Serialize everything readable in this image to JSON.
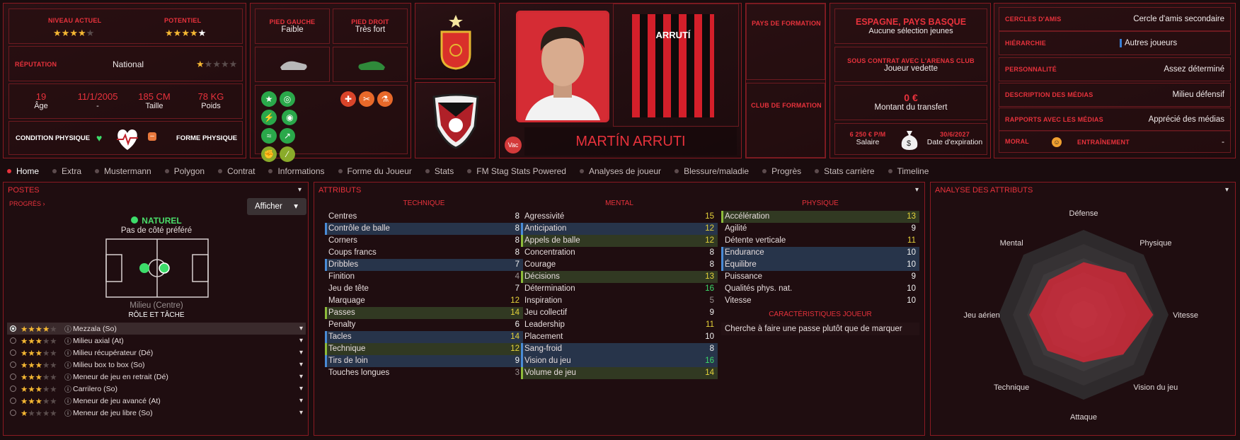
{
  "profile": {
    "current_level_label": "NIVEAU ACTUEL",
    "current_level_stars": 3.5,
    "potential_label": "POTENTIEL",
    "potential_stars": 4,
    "reputation_label": "RÉPUTATION",
    "reputation_value": "National",
    "reputation_stars": 0.5,
    "age": "19",
    "age_label": "Âge",
    "dob": "11/1/2005",
    "dob_label": "-",
    "height": "185 CM",
    "height_label": "Taille",
    "weight": "78 KG",
    "weight_label": "Poids",
    "condition_label": "CONDITION PHYSIQUE",
    "form_label": "FORME PHYSIQUE",
    "left_foot_label": "PIED GAUCHE",
    "left_foot_value": "Faible",
    "right_foot_label": "PIED DROIT",
    "right_foot_value": "Très fort",
    "name": "MARTÍN ARRUTI",
    "vac_badge": "Vac",
    "shirt_name": "ARRUTÍ",
    "training_nation_label": "PAYS DE FORMATION",
    "training_club_label": "CLUB DE FORMATION",
    "nationality": "ESPAGNE, PAYS BASQUE",
    "national_caps": "Aucune sélection jeunes",
    "contract_label": "SOUS CONTRAT AVEC L'ARENAS CLUB",
    "contract_status": "Joueur vedette",
    "transfer_value": "0 €",
    "transfer_label": "Montant du transfert",
    "salary": "6 250 € P/M",
    "salary_label": "Salaire",
    "expiry": "30/6/2027",
    "expiry_label": "Date d'expiration"
  },
  "right_info": [
    {
      "label": "CERCLES D'AMIS",
      "value": "Cercle d'amis secondaire"
    },
    {
      "label": "HIÉRARCHIE",
      "value": "Autres joueurs"
    },
    {
      "label": "PERSONNALITÉ",
      "value": "Assez déterminé"
    },
    {
      "label": "DESCRIPTION DES MÉDIAS",
      "value": "Milieu défensif"
    },
    {
      "label": "RAPPORTS AVEC LES MÉDIAS",
      "value": "Apprécié des médias"
    }
  ],
  "morale": {
    "label": "MORAL",
    "training_label": "ENTRAÎNEMENT",
    "training_value": "-"
  },
  "tabs": [
    "Home",
    "Extra",
    "Mustermann",
    "Polygon",
    "Contrat",
    "Informations",
    "Forme du Joueur",
    "Stats",
    "FM Stag Stats Powered",
    "Analyses de joueur",
    "Blessure/maladie",
    "Progrès",
    "Stats carrière",
    "Timeline"
  ],
  "positions": {
    "title": "POSTES",
    "progress_link": "PROGRÈS",
    "show_button": "Afficher",
    "natural": "NATUREL",
    "side": "Pas de côté préféré",
    "position": "Milieu (Centre)",
    "role_title": "RÔLE ET TÂCHE",
    "roles": [
      {
        "name": "Mezzala (So)",
        "stars": 3.5
      },
      {
        "name": "Milieu axial (At)",
        "stars": 3
      },
      {
        "name": "Milieu récupérateur (Dé)",
        "stars": 3
      },
      {
        "name": "Milieu box to box (So)",
        "stars": 3
      },
      {
        "name": "Meneur de jeu en retrait (Dé)",
        "stars": 3
      },
      {
        "name": "Carrilero (So)",
        "stars": 3
      },
      {
        "name": "Meneur de jeu avancé (At)",
        "stars": 2.5
      },
      {
        "name": "Meneur de jeu libre (So)",
        "stars": 1
      }
    ]
  },
  "attributes": {
    "title": "ATTRIBUTS",
    "technique_header": "TECHNIQUE",
    "mental_header": "MENTAL",
    "physique_header": "PHYSIQUE",
    "technique": [
      {
        "n": "Centres",
        "v": "8",
        "h": ""
      },
      {
        "n": "Contrôle de balle",
        "v": "8",
        "h": "b"
      },
      {
        "n": "Corners",
        "v": "8",
        "h": ""
      },
      {
        "n": "Coups francs",
        "v": "8",
        "h": ""
      },
      {
        "n": "Dribbles",
        "v": "7",
        "h": "b"
      },
      {
        "n": "Finition",
        "v": "4",
        "h": ""
      },
      {
        "n": "Jeu de tête",
        "v": "7",
        "h": ""
      },
      {
        "n": "Marquage",
        "v": "12",
        "h": ""
      },
      {
        "n": "Passes",
        "v": "14",
        "h": "g"
      },
      {
        "n": "Penalty",
        "v": "6",
        "h": ""
      },
      {
        "n": "Tacles",
        "v": "14",
        "h": "b"
      },
      {
        "n": "Technique",
        "v": "12",
        "h": "g"
      },
      {
        "n": "Tirs de loin",
        "v": "9",
        "h": "b"
      },
      {
        "n": "Touches longues",
        "v": "3",
        "h": ""
      }
    ],
    "mental": [
      {
        "n": "Agressivité",
        "v": "15",
        "h": ""
      },
      {
        "n": "Anticipation",
        "v": "12",
        "h": "b"
      },
      {
        "n": "Appels de balle",
        "v": "12",
        "h": "g"
      },
      {
        "n": "Concentration",
        "v": "8",
        "h": ""
      },
      {
        "n": "Courage",
        "v": "8",
        "h": ""
      },
      {
        "n": "Décisions",
        "v": "13",
        "h": "g"
      },
      {
        "n": "Détermination",
        "v": "16",
        "h": ""
      },
      {
        "n": "Inspiration",
        "v": "5",
        "h": ""
      },
      {
        "n": "Jeu collectif",
        "v": "9",
        "h": ""
      },
      {
        "n": "Leadership",
        "v": "11",
        "h": ""
      },
      {
        "n": "Placement",
        "v": "10",
        "h": ""
      },
      {
        "n": "Sang-froid",
        "v": "8",
        "h": "b"
      },
      {
        "n": "Vision du jeu",
        "v": "16",
        "h": "b"
      },
      {
        "n": "Volume de jeu",
        "v": "14",
        "h": "g"
      }
    ],
    "physique": [
      {
        "n": "Accélération",
        "v": "13",
        "h": "g"
      },
      {
        "n": "Agilité",
        "v": "9",
        "h": ""
      },
      {
        "n": "Détente verticale",
        "v": "11",
        "h": ""
      },
      {
        "n": "Endurance",
        "v": "10",
        "h": "b"
      },
      {
        "n": "Équilibre",
        "v": "10",
        "h": "b"
      },
      {
        "n": "Puissance",
        "v": "9",
        "h": ""
      },
      {
        "n": "Qualités phys. nat.",
        "v": "10",
        "h": ""
      },
      {
        "n": "Vitesse",
        "v": "10",
        "h": ""
      }
    ],
    "traits_header": "CARACTÉRISTIQUES JOUEUR",
    "trait": "Cherche à faire une passe plutôt que de marquer"
  },
  "analysis": {
    "title": "ANALYSE DES ATTRIBUTS",
    "axes": [
      "Défense",
      "Physique",
      "Vitesse",
      "Vision du jeu",
      "Attaque",
      "Technique",
      "Jeu aérien",
      "Mental"
    ],
    "values": [
      0.62,
      0.7,
      0.82,
      0.66,
      0.56,
      0.6,
      0.64,
      0.58
    ]
  }
}
